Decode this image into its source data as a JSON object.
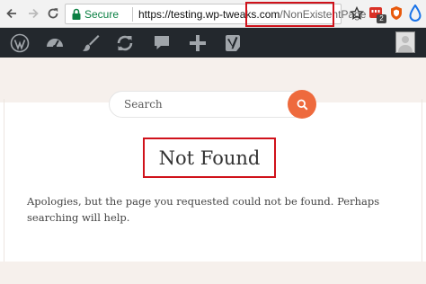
{
  "browser": {
    "secure_label": "Secure",
    "url_base": "https://testing.wp-tweaks.com",
    "url_path": "/NonExistentPage",
    "extension_badge": "2"
  },
  "search": {
    "placeholder": "Search"
  },
  "page": {
    "title": "Not Found",
    "message": "Apologies, but the page you requested could not be found. Perhaps searching will help."
  },
  "colors": {
    "admin_bar": "#23282d",
    "header_band": "#f6f0ec",
    "search_button": "#ee6a3d",
    "highlight": "#d0121b",
    "secure_green": "#0b8043"
  }
}
